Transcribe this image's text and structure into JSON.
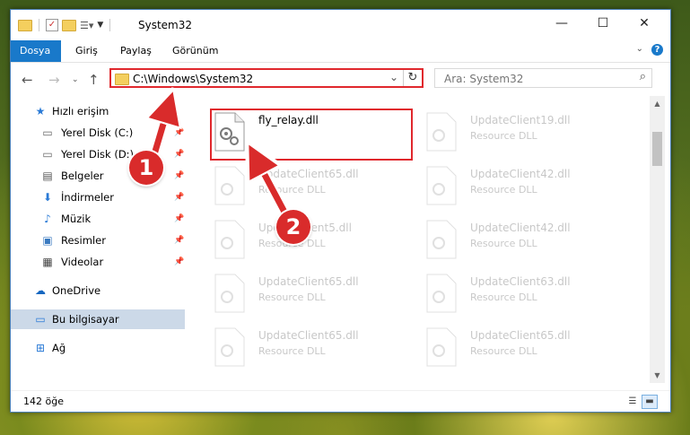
{
  "window": {
    "title": "System32",
    "controls": {
      "minimize": "—",
      "maximize": "☐",
      "close": "✕"
    }
  },
  "ribbon": {
    "tabs": [
      "Dosya",
      "Giriş",
      "Paylaş",
      "Görünüm"
    ],
    "help": "?"
  },
  "address": {
    "path": "C:\\Windows\\System32",
    "search_placeholder": "Ara: System32"
  },
  "nav": {
    "quick_access": "Hızlı erişim",
    "items": [
      {
        "label": "Yerel Disk (C:)",
        "icon": "drive-icon",
        "pinned": true
      },
      {
        "label": "Yerel Disk (D:)",
        "icon": "drive-icon",
        "pinned": true
      },
      {
        "label": "Belgeler",
        "icon": "documents-icon",
        "pinned": true
      },
      {
        "label": "İndirmeler",
        "icon": "downloads-icon",
        "pinned": true
      },
      {
        "label": "Müzik",
        "icon": "music-icon",
        "pinned": true
      },
      {
        "label": "Resimler",
        "icon": "pictures-icon",
        "pinned": true
      },
      {
        "label": "Videolar",
        "icon": "videos-icon",
        "pinned": true
      }
    ],
    "onedrive": "OneDrive",
    "this_pc": "Bu bilgisayar",
    "network": "Ağ"
  },
  "files": {
    "highlighted": {
      "name": "fly_relay.dll",
      "type": ""
    },
    "faded": [
      {
        "name": "UpdateClient19.dll",
        "type": "Resource DLL"
      },
      {
        "name": "UpdateClient65.dll",
        "type": "Resource DLL"
      },
      {
        "name": "UpdateClient42.dll",
        "type": "Resource DLL"
      },
      {
        "name": "UpdateClient5.dll",
        "type": "Resource DLL"
      },
      {
        "name": "UpdateClient42.dll",
        "type": "Resource DLL"
      },
      {
        "name": "UpdateClient65.dll",
        "type": "Resource DLL"
      },
      {
        "name": "UpdateClient63.dll",
        "type": "Resource DLL"
      },
      {
        "name": "UpdateClient65.dll",
        "type": "Resource DLL"
      },
      {
        "name": "UpdateClient65.dll",
        "type": "Resource DLL"
      }
    ]
  },
  "status": {
    "item_count": "142 öğe"
  },
  "annotations": {
    "step1": "1",
    "step2": "2"
  },
  "colors": {
    "accent": "#1979ca",
    "highlight": "#e0282d",
    "badge": "#d92b2b"
  }
}
